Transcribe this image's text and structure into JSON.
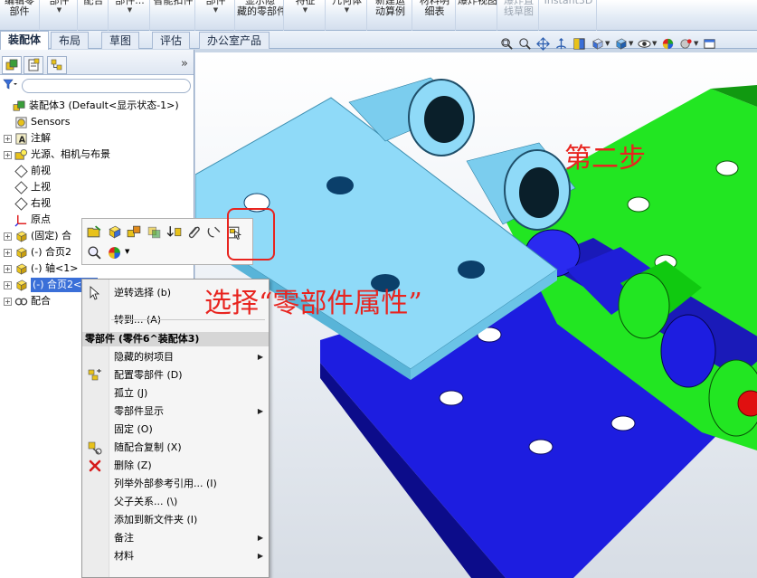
{
  "ribbon": {
    "items": [
      {
        "top": "编辑零",
        "bottom": "部件",
        "caret": false
      },
      {
        "top": "",
        "bottom": "部件",
        "caret": true
      },
      {
        "top": "",
        "bottom": "配合",
        "caret": false
      },
      {
        "top": "",
        "bottom": "部件...",
        "caret": true
      },
      {
        "top": "",
        "bottom": "智能扣件",
        "caret": false
      },
      {
        "top": "",
        "bottom": "部件",
        "caret": true
      },
      {
        "top": "显示隐",
        "bottom": "藏的零部件",
        "caret": false
      },
      {
        "top": "",
        "bottom": "特征",
        "caret": true
      },
      {
        "top": "",
        "bottom": "几何体",
        "caret": true
      },
      {
        "top": "新建运",
        "bottom": "动算例",
        "caret": false
      },
      {
        "top": "材料明",
        "bottom": "细表",
        "caret": false
      },
      {
        "top": "",
        "bottom": "爆炸视图",
        "caret": false
      },
      {
        "top": "爆炸直",
        "bottom": "线草图",
        "caret": false,
        "disabled": true
      },
      {
        "top": "",
        "bottom": "Instant3D",
        "caret": false,
        "disabled": true
      }
    ]
  },
  "tabs": [
    "装配体",
    "布局",
    "草图",
    "评估",
    "办公室产品"
  ],
  "active_tab": "装配体",
  "view_toolbar_icons": [
    "zoom-to-fit-icon",
    "zoom-to-area-icon",
    "pan-icon",
    "rotate-icon",
    "section-view-icon",
    "view-orientation-icon",
    "display-style-icon",
    "hide-show-icon",
    "edit-appearance-icon",
    "apply-scene-icon",
    "view-settings-icon"
  ],
  "panel": {
    "tabs": [
      "feature-manager-icon",
      "property-manager-icon",
      "configuration-manager-icon"
    ],
    "more": "»",
    "tree": [
      {
        "label": "装配体3  (Default<显示状态-1>)",
        "icon": "assembly-icon",
        "exp": "",
        "level": 0
      },
      {
        "label": "Sensors",
        "icon": "sensor-icon",
        "exp": "",
        "level": 1
      },
      {
        "label": "注解",
        "icon": "annotation-icon",
        "exp": "+",
        "level": 1
      },
      {
        "label": "光源、相机与布景",
        "icon": "lights-icon",
        "exp": "+",
        "level": 1
      },
      {
        "label": "前视",
        "icon": "plane-icon",
        "exp": "",
        "level": 1
      },
      {
        "label": "上视",
        "icon": "plane-icon",
        "exp": "",
        "level": 1
      },
      {
        "label": "右视",
        "icon": "plane-icon",
        "exp": "",
        "level": 1
      },
      {
        "label": "原点",
        "icon": "origin-icon",
        "exp": "",
        "level": 1
      },
      {
        "label": "(固定) 合",
        "icon": "part-icon",
        "exp": "+",
        "level": 1
      },
      {
        "label": "(-) 合页2",
        "icon": "part-icon",
        "exp": "+",
        "level": 1
      },
      {
        "label": "(-) 轴<1>",
        "icon": "part-icon",
        "exp": "+",
        "level": 1
      },
      {
        "label": "(-) 合页2<2>",
        "icon": "part-icon",
        "exp": "+",
        "level": 1,
        "selected": true
      },
      {
        "label": "配合",
        "icon": "mates-icon",
        "exp": "+",
        "level": 1
      }
    ]
  },
  "context_toolbar": {
    "row1": [
      "open-part-icon",
      "edit-part-icon",
      "edit-assembly-icon",
      "change-transparency-icon",
      "move-component-icon",
      "attach-icon",
      "mate-icon",
      "component-properties-icon"
    ],
    "row2": [
      "zoom-to-selection-icon",
      "appearance-icon"
    ]
  },
  "context_menu": {
    "items_top": [
      {
        "label": "逆转选择  (b)",
        "icon": "select-cursor-icon",
        "arrow": false
      },
      {
        "label": "转到...  (A)",
        "icon": "",
        "arrow": false
      }
    ],
    "header": "零部件  (零件6^装配体3)",
    "items": [
      {
        "label": "隐藏的树项目",
        "icon": "",
        "arrow": true
      },
      {
        "label": "配置零部件  (D)",
        "icon": "configure-component-icon",
        "arrow": false
      },
      {
        "label": "孤立  (J)",
        "icon": "",
        "arrow": false
      },
      {
        "label": "零部件显示",
        "icon": "",
        "arrow": true
      },
      {
        "label": "固定  (O)",
        "icon": "",
        "arrow": false
      },
      {
        "label": "随配合复制  (X)",
        "icon": "copy-with-mates-icon",
        "arrow": false
      },
      {
        "label": "删除  (Z)",
        "icon": "delete-icon",
        "arrow": false
      },
      {
        "label": "列举外部参考引用...  (I)",
        "icon": "",
        "arrow": false
      },
      {
        "label": "父子关系...  (\\)",
        "icon": "",
        "arrow": false
      },
      {
        "label": "添加到新文件夹  (I)",
        "icon": "",
        "arrow": false
      },
      {
        "label": "备注",
        "icon": "",
        "arrow": true
      },
      {
        "label": "材料",
        "icon": "",
        "arrow": true
      }
    ]
  },
  "annotations": {
    "step": "第二步",
    "select": "选择“零部件属性”"
  },
  "colors": {
    "highlight": "#e8241f",
    "cyan_part": "#8fd8f8",
    "green_part": "#22e622",
    "blue_part": "#1a1ae6",
    "selection": "#3a6fd8"
  }
}
